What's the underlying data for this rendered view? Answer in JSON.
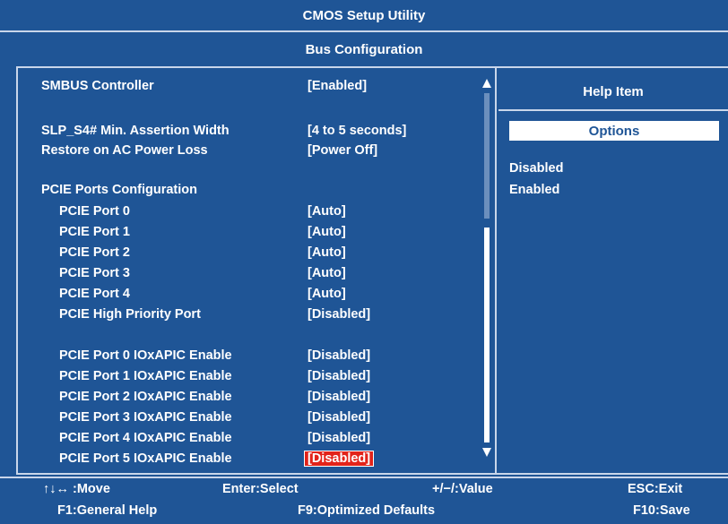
{
  "app": {
    "title": "CMOS Setup Utility",
    "page": "Bus Configuration"
  },
  "settings": [
    {
      "label": "SMBUS Controller",
      "value": "[Enabled]"
    },
    {
      "label": "SLP_S4# Min. Assertion Width",
      "value": "[4 to 5 seconds]"
    },
    {
      "label": "Restore on AC Power Loss",
      "value": "[Power Off]"
    },
    {
      "label": "PCIE Ports Configuration",
      "value": ""
    },
    {
      "label": "PCIE Port 0",
      "value": "[Auto]"
    },
    {
      "label": "PCIE Port 1",
      "value": "[Auto]"
    },
    {
      "label": "PCIE Port 2",
      "value": "[Auto]"
    },
    {
      "label": "PCIE Port 3",
      "value": "[Auto]"
    },
    {
      "label": "PCIE Port 4",
      "value": "[Auto]"
    },
    {
      "label": "PCIE High Priority Port",
      "value": "[Disabled]"
    },
    {
      "label": "PCIE Port 0 IOxAPIC Enable",
      "value": "[Disabled]"
    },
    {
      "label": "PCIE Port 1 IOxAPIC Enable",
      "value": "[Disabled]"
    },
    {
      "label": "PCIE Port 2 IOxAPIC Enable",
      "value": "[Disabled]"
    },
    {
      "label": "PCIE Port 3 IOxAPIC Enable",
      "value": "[Disabled]"
    },
    {
      "label": "PCIE Port 4 IOxAPIC Enable",
      "value": "[Disabled]"
    },
    {
      "label": "PCIE Port 5 IOxAPIC Enable",
      "value": "[Disabled]"
    }
  ],
  "help": {
    "title": "Help Item",
    "options_header": "Options",
    "options": [
      "Disabled",
      "Enabled"
    ]
  },
  "footer": {
    "move": "↑↓↔ :Move",
    "select": "Enter:Select",
    "value": "+/−/:Value",
    "exit": "ESC:Exit",
    "general_help": "F1:General Help",
    "defaults": "F9:Optimized Defaults",
    "save": "F10:Save"
  },
  "colors": {
    "background": "#1f5596",
    "text": "#ffffff",
    "selection": "#e2231a"
  }
}
